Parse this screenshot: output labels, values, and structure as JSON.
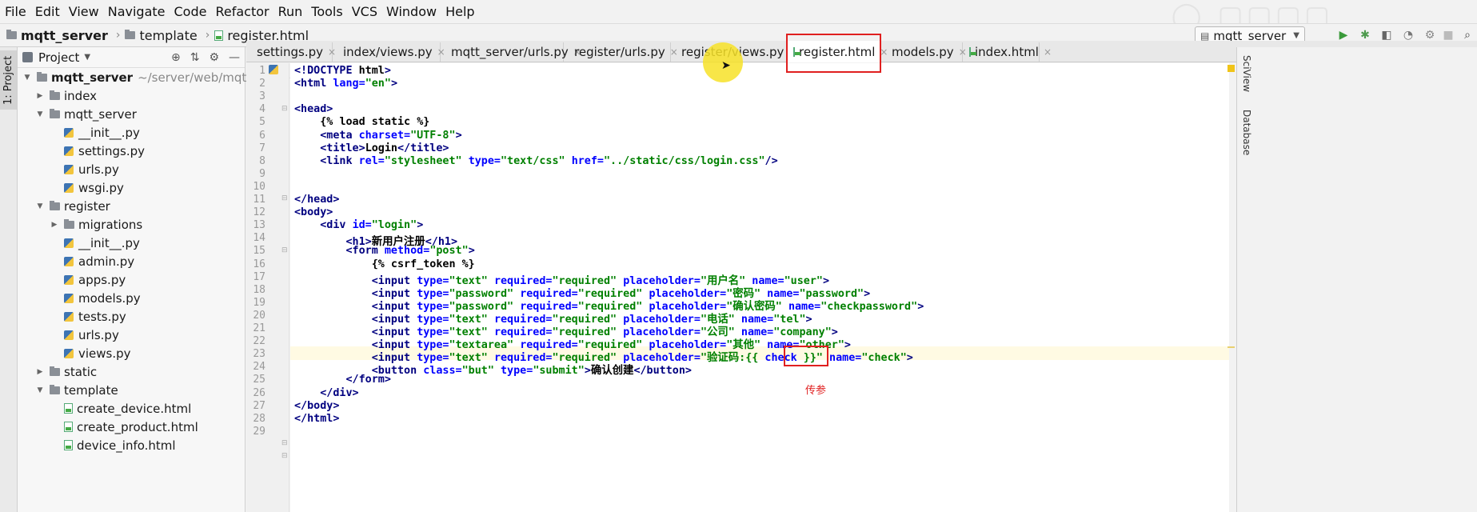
{
  "menu": [
    "File",
    "Edit",
    "View",
    "Navigate",
    "Code",
    "Refactor",
    "Run",
    "Tools",
    "VCS",
    "Window",
    "Help"
  ],
  "breadcrumb": {
    "project": "mqtt_server",
    "folder": "template",
    "file": "register.html"
  },
  "run_config": "mqtt_server",
  "left_strip_label": "1: Project",
  "project_panel": {
    "title": "Project",
    "root_name": "mqtt_server",
    "root_path": "~/server/web/mqtt_server",
    "items": [
      {
        "label": "index",
        "type": "folder",
        "indent": 1,
        "toggle": "▶"
      },
      {
        "label": "mqtt_server",
        "type": "folder",
        "indent": 1,
        "toggle": "▼"
      },
      {
        "label": "__init__.py",
        "type": "py",
        "indent": 2
      },
      {
        "label": "settings.py",
        "type": "py",
        "indent": 2
      },
      {
        "label": "urls.py",
        "type": "py",
        "indent": 2
      },
      {
        "label": "wsgi.py",
        "type": "py",
        "indent": 2
      },
      {
        "label": "register",
        "type": "folder",
        "indent": 1,
        "toggle": "▼"
      },
      {
        "label": "migrations",
        "type": "folder",
        "indent": 2,
        "toggle": "▶"
      },
      {
        "label": "__init__.py",
        "type": "py",
        "indent": 2
      },
      {
        "label": "admin.py",
        "type": "py",
        "indent": 2
      },
      {
        "label": "apps.py",
        "type": "py",
        "indent": 2
      },
      {
        "label": "models.py",
        "type": "py",
        "indent": 2
      },
      {
        "label": "tests.py",
        "type": "py",
        "indent": 2
      },
      {
        "label": "urls.py",
        "type": "py",
        "indent": 2
      },
      {
        "label": "views.py",
        "type": "py",
        "indent": 2
      },
      {
        "label": "static",
        "type": "folder",
        "indent": 1,
        "toggle": "▶"
      },
      {
        "label": "template",
        "type": "folder",
        "indent": 1,
        "toggle": "▼"
      },
      {
        "label": "create_device.html",
        "type": "html",
        "indent": 2
      },
      {
        "label": "create_product.html",
        "type": "html",
        "indent": 2
      },
      {
        "label": "device_info.html",
        "type": "html",
        "indent": 2
      }
    ]
  },
  "tabs": [
    {
      "label": "settings.py",
      "type": "py"
    },
    {
      "label": "index/views.py",
      "type": "py"
    },
    {
      "label": "mqtt_server/urls.py",
      "type": "py"
    },
    {
      "label": "register/urls.py",
      "type": "py"
    },
    {
      "label": "register/views.py",
      "type": "py"
    },
    {
      "label": "register.html",
      "type": "html",
      "active": true
    },
    {
      "label": "models.py",
      "type": "py"
    },
    {
      "label": "index.html",
      "type": "html"
    }
  ],
  "right_strip": [
    "SciView",
    "Database"
  ],
  "annotation_text": "传参",
  "colors": {
    "annotation": "#e02020",
    "highlight": "#f7e228"
  },
  "code_lines": [
    [
      [
        "tg",
        "<!DOCTYPE "
      ],
      [
        "tp",
        "html"
      ],
      [
        "tg",
        ">"
      ]
    ],
    [
      [
        "tg",
        "<html "
      ],
      [
        "at",
        "lang="
      ],
      [
        "st",
        "\"en\""
      ],
      [
        "tg",
        ">"
      ]
    ],
    [],
    [
      [
        "tg",
        "<head>"
      ]
    ],
    [
      [
        "tp",
        "    {% "
      ],
      [
        "tp",
        "load static "
      ],
      [
        "tp",
        "%}"
      ]
    ],
    [
      [
        "tg",
        "    <meta "
      ],
      [
        "at",
        "charset="
      ],
      [
        "st",
        "\"UTF-8\""
      ],
      [
        "tg",
        ">"
      ]
    ],
    [
      [
        "tg",
        "    <title>"
      ],
      [
        "tp",
        "Login"
      ],
      [
        "tg",
        "</title>"
      ]
    ],
    [
      [
        "tg",
        "    <link "
      ],
      [
        "at",
        "rel="
      ],
      [
        "st",
        "\"stylesheet\" "
      ],
      [
        "at",
        "type="
      ],
      [
        "st",
        "\"text/css\" "
      ],
      [
        "at",
        "href="
      ],
      [
        "st",
        "\"../static/css/login.css\""
      ],
      [
        "tg",
        "/>"
      ]
    ],
    [],
    [],
    [
      [
        "tg",
        "</head>"
      ]
    ],
    [
      [
        "tg",
        "<body>"
      ]
    ],
    [
      [
        "tg",
        "    <div "
      ],
      [
        "at",
        "id="
      ],
      [
        "st",
        "\"login\""
      ],
      [
        "tg",
        ">"
      ]
    ],
    [
      [
        "tg",
        "        <h1>"
      ],
      [
        "tp",
        "新用户注册"
      ],
      [
        "tg",
        "</h1>"
      ]
    ],
    [
      [
        "tg",
        "        <form "
      ],
      [
        "at",
        "method="
      ],
      [
        "st",
        "\"post\""
      ],
      [
        "tg",
        ">"
      ]
    ],
    [
      [
        "tp",
        "            {% csrf_token %}"
      ]
    ],
    [
      [
        "tg",
        "            <input "
      ],
      [
        "at",
        "type="
      ],
      [
        "st",
        "\"text\" "
      ],
      [
        "at",
        "required="
      ],
      [
        "st",
        "\"required\" "
      ],
      [
        "at",
        "placeholder="
      ],
      [
        "st",
        "\"用户名\" "
      ],
      [
        "at",
        "name="
      ],
      [
        "st",
        "\"user\""
      ],
      [
        "tg",
        ">"
      ]
    ],
    [
      [
        "tg",
        "            <input "
      ],
      [
        "at",
        "type="
      ],
      [
        "st",
        "\"password\" "
      ],
      [
        "at",
        "required="
      ],
      [
        "st",
        "\"required\" "
      ],
      [
        "at",
        "placeholder="
      ],
      [
        "st",
        "\"密码\" "
      ],
      [
        "at",
        "name="
      ],
      [
        "st",
        "\"password\""
      ],
      [
        "tg",
        ">"
      ]
    ],
    [
      [
        "tg",
        "            <input "
      ],
      [
        "at",
        "type="
      ],
      [
        "st",
        "\"password\" "
      ],
      [
        "at",
        "required="
      ],
      [
        "st",
        "\"required\" "
      ],
      [
        "at",
        "placeholder="
      ],
      [
        "st",
        "\"确认密码\" "
      ],
      [
        "at",
        "name="
      ],
      [
        "st",
        "\"checkpassword\""
      ],
      [
        "tg",
        ">"
      ]
    ],
    [
      [
        "tg",
        "            <input "
      ],
      [
        "at",
        "type="
      ],
      [
        "st",
        "\"text\" "
      ],
      [
        "at",
        "required="
      ],
      [
        "st",
        "\"required\" "
      ],
      [
        "at",
        "placeholder="
      ],
      [
        "st",
        "\"电话\" "
      ],
      [
        "at",
        "name="
      ],
      [
        "st",
        "\"tel\""
      ],
      [
        "tg",
        ">"
      ]
    ],
    [
      [
        "tg",
        "            <input "
      ],
      [
        "at",
        "type="
      ],
      [
        "st",
        "\"text\" "
      ],
      [
        "at",
        "required="
      ],
      [
        "st",
        "\"required\" "
      ],
      [
        "at",
        "placeholder="
      ],
      [
        "st",
        "\"公司\" "
      ],
      [
        "at",
        "name="
      ],
      [
        "st",
        "\"company\""
      ],
      [
        "tg",
        ">"
      ]
    ],
    [
      [
        "tg",
        "            <input "
      ],
      [
        "at",
        "type="
      ],
      [
        "st",
        "\"textarea\" "
      ],
      [
        "at",
        "required="
      ],
      [
        "st",
        "\"required\" "
      ],
      [
        "at",
        "placeholder="
      ],
      [
        "st",
        "\"其他\" "
      ],
      [
        "at",
        "name="
      ],
      [
        "st",
        "\"other\""
      ],
      [
        "tg",
        ">"
      ]
    ],
    [
      [
        "tg",
        "            <input "
      ],
      [
        "at",
        "type="
      ],
      [
        "st",
        "\"text\" "
      ],
      [
        "at",
        "required="
      ],
      [
        "st",
        "\"required\" "
      ],
      [
        "at",
        "placeholder="
      ],
      [
        "st",
        "\"验证码:{{ "
      ],
      [
        "at",
        "check"
      ],
      [
        "st",
        " }}\" "
      ],
      [
        "at",
        "name="
      ],
      [
        "st",
        "\"check\""
      ],
      [
        "tg",
        ">"
      ]
    ],
    [
      [
        "tg",
        "            <button "
      ],
      [
        "at",
        "class="
      ],
      [
        "st",
        "\"but\" "
      ],
      [
        "at",
        "type="
      ],
      [
        "st",
        "\"submit\""
      ],
      [
        "tg",
        ">"
      ],
      [
        "tp",
        "确认创建"
      ],
      [
        "tg",
        "</button>"
      ]
    ],
    [
      [
        "tg",
        "        </form>"
      ]
    ],
    [
      [
        "tg",
        "    </div>"
      ]
    ],
    [
      [
        "tg",
        "</body>"
      ]
    ],
    [
      [
        "tg",
        "</html>"
      ]
    ],
    []
  ]
}
